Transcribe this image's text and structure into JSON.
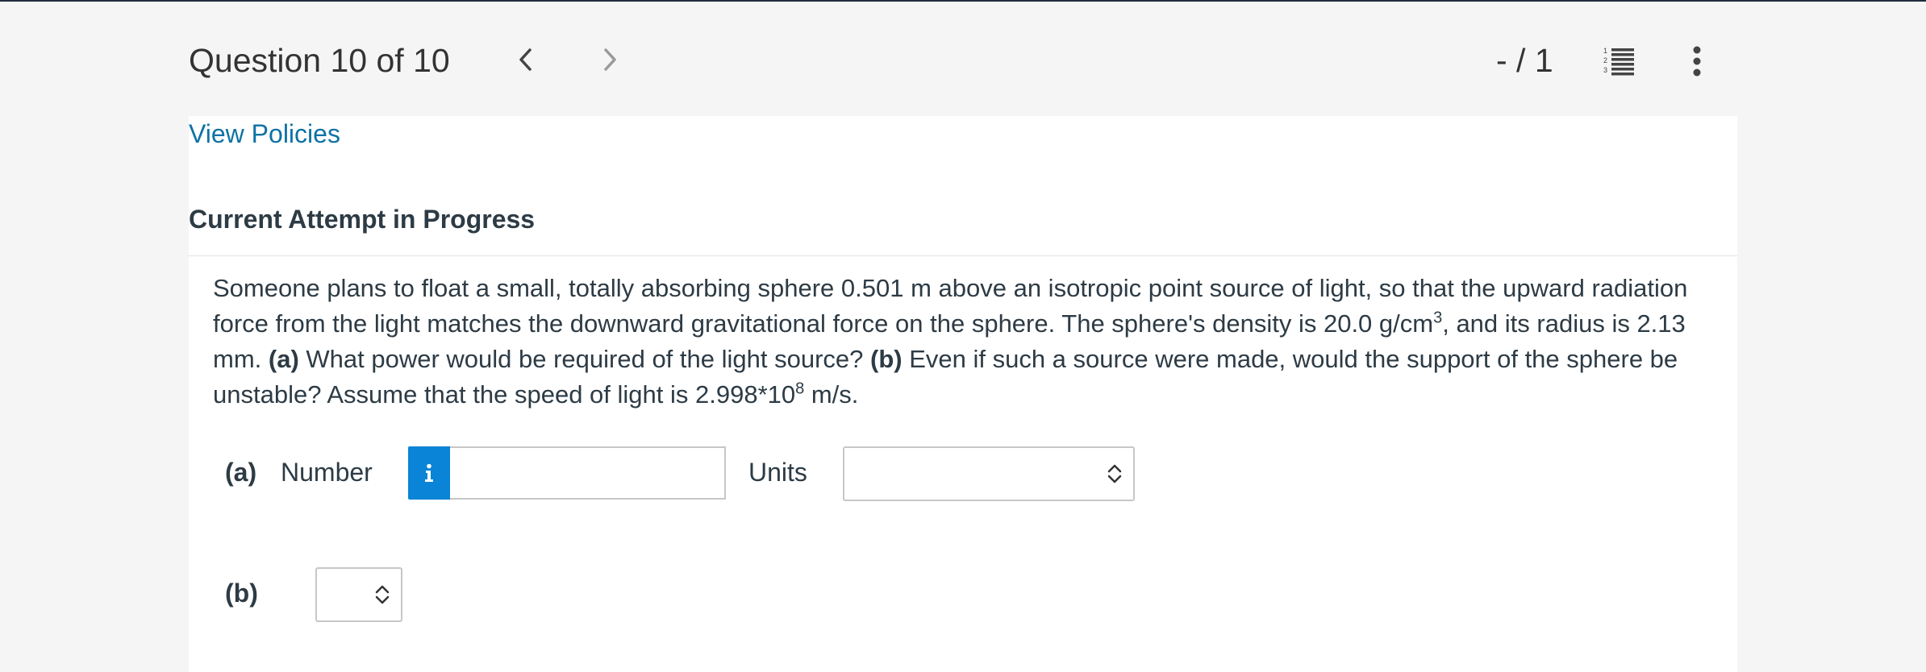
{
  "header": {
    "question_counter": "Question 10 of 10",
    "score": "- / 1"
  },
  "policies_link": "View Policies",
  "attempt_heading": "Current Attempt in Progress",
  "question": {
    "line1": "Someone plans to float a small, totally absorbing sphere 0.501 m above an isotropic point source of light, so that the upward radiation",
    "line2_pre": "force from the light matches the downward gravitational force on the sphere. The sphere's density is 20.0 g/cm",
    "line2_sup": "3",
    "line2_post": ", and its radius is 2.13",
    "line3_pre": "mm. ",
    "part_a_tag": "(a)",
    "part_a_text": " What power would be required of the light source? ",
    "part_b_tag": "(b)",
    "part_b_text": " Even if such a source were made, would the support of the sphere be",
    "line4_pre": "unstable? Assume that the speed of light is 2.998*10",
    "line4_sup": "8",
    "line4_post": " m/s."
  },
  "part_a": {
    "label": "(a)",
    "number_label": "Number",
    "number_value": "",
    "units_label": "Units",
    "units_value": ""
  },
  "part_b": {
    "label": "(b)",
    "value": ""
  },
  "icons": [
    "chevron-left-icon",
    "chevron-right-icon",
    "question-list-icon",
    "more-vertical-icon",
    "info-icon",
    "select-updown-icon"
  ],
  "colors": {
    "link": "#0e72a5",
    "info_button": "#0a84d6",
    "text": "#2d3b45"
  }
}
